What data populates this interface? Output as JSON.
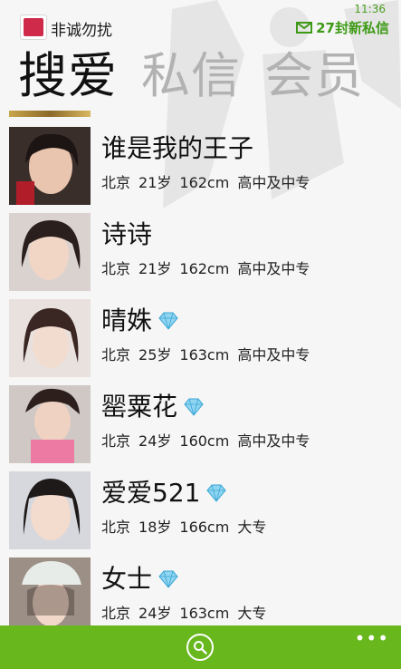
{
  "status": {
    "time": "11:36"
  },
  "app": {
    "name": "非诚勿扰"
  },
  "notice": {
    "text": "27封新私信"
  },
  "pivot": {
    "tabs": [
      "搜爱",
      "私信",
      "会员"
    ]
  },
  "profiles": [
    {
      "name": "谁是我的王子",
      "city": "北京",
      "age": "21岁",
      "height": "162cm",
      "education": "高中及中专",
      "vip": false,
      "icon": "portrait"
    },
    {
      "name": "诗诗",
      "city": "北京",
      "age": "21岁",
      "height": "162cm",
      "education": "高中及中专",
      "vip": false,
      "icon": "portrait"
    },
    {
      "name": "晴姝",
      "city": "北京",
      "age": "25岁",
      "height": "163cm",
      "education": "高中及中专",
      "vip": true,
      "icon": "portrait"
    },
    {
      "name": "罂粟花",
      "city": "北京",
      "age": "24岁",
      "height": "160cm",
      "education": "高中及中专",
      "vip": true,
      "icon": "portrait"
    },
    {
      "name": "爱爱521",
      "city": "北京",
      "age": "18岁",
      "height": "166cm",
      "education": "大专",
      "vip": true,
      "icon": "portrait"
    },
    {
      "name": "女士",
      "city": "北京",
      "age": "24岁",
      "height": "163cm",
      "education": "大专",
      "vip": true,
      "icon": "portrait"
    }
  ],
  "appbar": {
    "more": "•••"
  },
  "colors": {
    "accent": "#67b71d",
    "notice": "#3e9a16",
    "inactive_tab": "#b2b2b2",
    "diamond": "#8fd4f0"
  }
}
